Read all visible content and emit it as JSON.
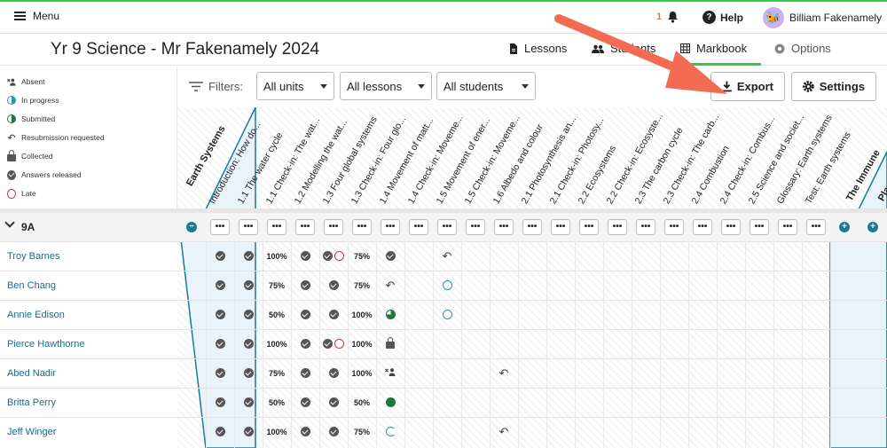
{
  "topbar": {
    "menu_label": "Menu",
    "notifications_count": "1",
    "help_label": "Help",
    "user_name": "Billiam Fakenamely"
  },
  "header": {
    "title": "Yr 9 Science - Mr Fakenamely 2024",
    "tabs": [
      {
        "label": "Lessons"
      },
      {
        "label": "Students"
      },
      {
        "label": "Markbook"
      },
      {
        "label": "Options"
      }
    ],
    "active_tab": "Markbook"
  },
  "legend": {
    "items": [
      {
        "label": "Absent",
        "icon": "absent-icon"
      },
      {
        "label": "In progress",
        "icon": "in-progress-icon"
      },
      {
        "label": "Submitted",
        "icon": "submitted-icon"
      },
      {
        "label": "Resubmission requested",
        "icon": "resubmission-icon"
      },
      {
        "label": "Collected",
        "icon": "collected-icon"
      },
      {
        "label": "Answers released",
        "icon": "answers-released-icon"
      },
      {
        "label": "Late",
        "icon": "late-icon"
      }
    ]
  },
  "filters": {
    "label": "Filters:",
    "units": "All units",
    "lessons": "All lessons",
    "students": "All students"
  },
  "actions": {
    "export": "Export",
    "settings": "Settings"
  },
  "colors": {
    "accent": "#2ecc40",
    "teal": "#1a9bc4",
    "orange": "#e8892b",
    "link": "#1d6b8c"
  },
  "units": [
    {
      "label": "Earth Systems"
    },
    {
      "label": "The Immune"
    },
    {
      "label": "Pla"
    }
  ],
  "columns": [
    "Introduction: How do...",
    "1.1 The water cycle",
    "1.1 Check-in: The wat...",
    "1.2 Modelling the wat...",
    "1.3 Four global systems",
    "1.3 Check-in: Four glo...",
    "1.4 Movement of matt...",
    "1.4 Check-in: Moveme...",
    "1.5 Movement of ener...",
    "1.5 Check-in: Moveme...",
    "1.6 Albedo and colour",
    "2.1 Photosynthesis an...",
    "2.1 Check-in: Photosy...",
    "2.2 Ecosystems",
    "2.2 Check-in: Ecosyste...",
    "2.3 The carbon cycle",
    "2.3 Check-in: The carb...",
    "2.4 Combustion",
    "2.4 Check-in: Combus...",
    "2.5 Science and societ...",
    "Glossary: Earth systems",
    "Test: Earth systems"
  ],
  "group": {
    "name": "9A"
  },
  "students": [
    {
      "name": "Troy Barnes",
      "cells": [
        "check",
        "check",
        "100%",
        "check",
        "check-late",
        "75%",
        "check",
        "",
        "resub",
        "",
        "",
        "",
        "",
        "",
        "",
        "",
        "",
        "",
        "",
        "",
        "",
        ""
      ]
    },
    {
      "name": "Ben Chang",
      "cells": [
        "check",
        "check",
        "75%",
        "check",
        "check",
        "75%",
        "resub",
        "",
        "ring",
        "",
        "",
        "",
        "",
        "",
        "",
        "",
        "",
        "",
        "",
        "",
        "",
        ""
      ]
    },
    {
      "name": "Annie Edison",
      "cells": [
        "check",
        "check",
        "50%",
        "check",
        "check",
        "100%",
        "halfgreen",
        "",
        "ring",
        "",
        "",
        "",
        "",
        "",
        "",
        "",
        "",
        "",
        "",
        "",
        "",
        ""
      ]
    },
    {
      "name": "Pierce Hawthorne",
      "cells": [
        "check",
        "check",
        "100%",
        "check",
        "check-late",
        "100%",
        "lock",
        "",
        "",
        "",
        "",
        "",
        "",
        "",
        "",
        "",
        "",
        "",
        "",
        "",
        "",
        ""
      ]
    },
    {
      "name": "Abed Nadir",
      "cells": [
        "check",
        "check",
        "75%",
        "check",
        "check",
        "100%",
        "absent",
        "",
        "",
        "",
        "resub",
        "",
        "",
        "",
        "",
        "",
        "",
        "",
        "",
        "",
        "",
        ""
      ]
    },
    {
      "name": "Britta Perry",
      "cells": [
        "check",
        "check",
        "50%",
        "check",
        "check",
        "50%",
        "greendot",
        "",
        "",
        "",
        "",
        "",
        "",
        "",
        "",
        "",
        "",
        "",
        "",
        "",
        "",
        ""
      ]
    },
    {
      "name": "Jeff Winger",
      "cells": [
        "check",
        "check",
        "100%",
        "check",
        "check",
        "75%",
        "progress",
        "",
        "",
        "",
        "resub",
        "",
        "",
        "",
        "",
        "",
        "",
        "",
        "",
        "",
        "",
        ""
      ]
    }
  ]
}
